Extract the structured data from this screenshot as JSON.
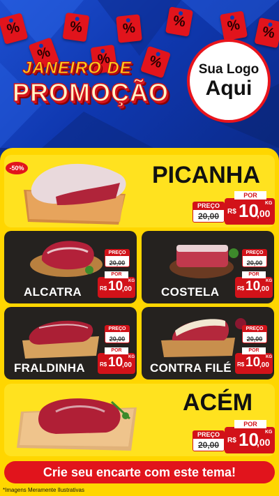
{
  "header": {
    "headline_line1": "JANEIRO DE",
    "headline_line2": "PROMOÇÃO",
    "logo_line1": "Sua Logo",
    "logo_line2": "Aqui",
    "tag_symbol": "%"
  },
  "discount_badge": "-50%",
  "currency": "R$",
  "unit": "KG",
  "preco_label": "PREÇO",
  "por_label": "POR",
  "products": [
    {
      "name": "PICANHA",
      "old_price": "20,00",
      "price_int": "10",
      "price_dec": ",00"
    },
    {
      "name": "ALCATRA",
      "old_price": "20,00",
      "price_int": "10",
      "price_dec": ",00"
    },
    {
      "name": "COSTELA",
      "old_price": "20,00",
      "price_int": "10",
      "price_dec": ",00"
    },
    {
      "name": "FRALDINHA",
      "old_price": "20,00",
      "price_int": "10",
      "price_dec": ",00"
    },
    {
      "name": "CONTRA FILÉ",
      "old_price": "20,00",
      "price_int": "10",
      "price_dec": ",00"
    },
    {
      "name": "ACÉM",
      "old_price": "20,00",
      "price_int": "10",
      "price_dec": ",00"
    }
  ],
  "cta": "Crie seu encarte com este tema!",
  "disclaimer": "*Imagens Meramente Ilustrativas",
  "colors": {
    "brand_red": "#e1141c",
    "brand_yellow": "#ffd600",
    "header_blue": "#0f38b0",
    "card_dark": "#25221f"
  }
}
